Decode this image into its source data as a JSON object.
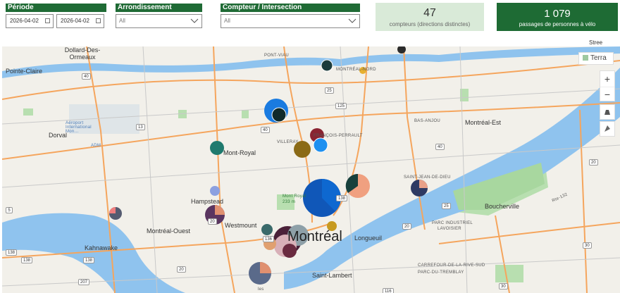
{
  "filters": {
    "periode": {
      "label": "Période",
      "start": "2026-04-02",
      "end": "2026-04-02"
    },
    "arrondissement": {
      "label": "Arrondissement",
      "value": "All"
    },
    "compteur": {
      "label": "Compteur / Intersection",
      "value": "All"
    }
  },
  "kpis": {
    "counters": {
      "value": "47",
      "caption": "compteurs (directions distinctes)"
    },
    "passages": {
      "value": "1 079",
      "caption": "passages de personnes à vélo"
    }
  },
  "header_fragment": "Stree",
  "map": {
    "layer_button": "Terra",
    "zoom_in": "+",
    "zoom_out": "−",
    "labels": {
      "pointe_claire": "Pointe-Claire",
      "dollard": "Dollard-Des-Ormeaux",
      "pont_viau": "PONT-VIAU",
      "montreal_nord": "MONTRÉAL-NORD",
      "aeroport": "Aéroport International Mon...",
      "adm": "ADM",
      "dorval": "Dorval",
      "mont_royal": "Mont-Royal",
      "villeray": "VILLERAY",
      "francois_perrault": "FRANÇOIS-PERRAULT",
      "bas_anjou": "BAS-ANJOU",
      "montreal_est": "Montréal-Est",
      "st_jean": "SAINT-JEAN-DE-DIEU",
      "hampstead": "Hampstead",
      "mont_royal_park": "Mont Royal",
      "mont_royal_elev": "233 m",
      "westmount": "Westmount",
      "montreal_ouest": "Montréal-Ouest",
      "montreal": "Montréal",
      "boucherville": "Boucherville",
      "parc_industriel": "PARC INDUSTRIEL",
      "lavoisier": "LAVOISIER",
      "longueuil": "Longueuil",
      "kahnawake": "Kahnawake",
      "saint_lambert": "Saint-Lambert",
      "carrefour": "CARREFOUR-DE-LA-RIVE-SUD",
      "parc_tremblay": "PARC-DU-TREMBLAY",
      "route_132": "Rte-132",
      "iles": "les"
    },
    "shields": [
      "40",
      "13",
      "25",
      "125",
      "40",
      "138",
      "136",
      "20",
      "20",
      "138",
      "138",
      "207",
      "20",
      "25",
      "30",
      "116",
      "30",
      "40",
      "20",
      "5",
      "138"
    ]
  },
  "colors": {
    "accent_green": "#1e6b34",
    "kpi_light_bg": "#d9ead8",
    "water": "#8fc3ee",
    "road": "#f5a55d",
    "park": "#b8dfb0"
  }
}
